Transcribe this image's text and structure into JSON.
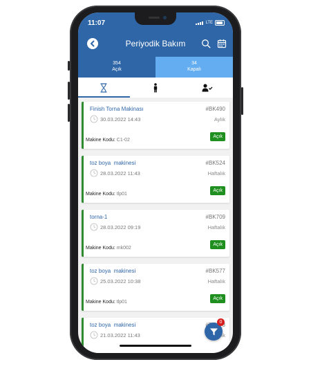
{
  "status": {
    "time": "11:07",
    "network": "LTE"
  },
  "header": {
    "title": "Periyodik Bakım"
  },
  "count_tabs": [
    {
      "count": "354",
      "label": "Açık"
    },
    {
      "count": "34",
      "label": "Kapalı"
    }
  ],
  "icon_tabs": [
    {
      "icon": "hourglass-icon"
    },
    {
      "icon": "person-icon"
    },
    {
      "icon": "person-check-icon"
    }
  ],
  "cards": [
    {
      "title": "Finish Torna Makinası",
      "code": "#BK490",
      "date": "30.03.2022 14:43",
      "period": "Aylık",
      "machine_label": "Makine Kodu:",
      "machine_code": "C1-02",
      "status": "Açık"
    },
    {
      "title": "toz boya  makinesi",
      "code": "#BK524",
      "date": "28.03.2022 11:43",
      "period": "Haftalık",
      "machine_label": "Makine Kodu:",
      "machine_code": "tlp01",
      "status": "Açık"
    },
    {
      "title": "torna-1",
      "code": "#BK709",
      "date": "28.03.2022 09:19",
      "period": "Haftalık",
      "machine_label": "Makine Kodu:",
      "machine_code": "mk002",
      "status": "Açık"
    },
    {
      "title": "toz boya  makinesi",
      "code": "#BK577",
      "date": "25.03.2022 10:38",
      "period": "Haftalık",
      "machine_label": "Makine Kodu:",
      "machine_code": "tlp01",
      "status": "Açık"
    },
    {
      "title": "toz boya  makinesi",
      "code": "#BK__3",
      "date": "21.03.2022 11:43",
      "period": "ık",
      "machine_label": "",
      "machine_code": "",
      "status": ""
    }
  ],
  "filter": {
    "badge_count": "0"
  },
  "colors": {
    "primary": "#2f66a8",
    "secondary": "#63adf0",
    "success": "#1f8f1f",
    "alert": "#d62020"
  }
}
